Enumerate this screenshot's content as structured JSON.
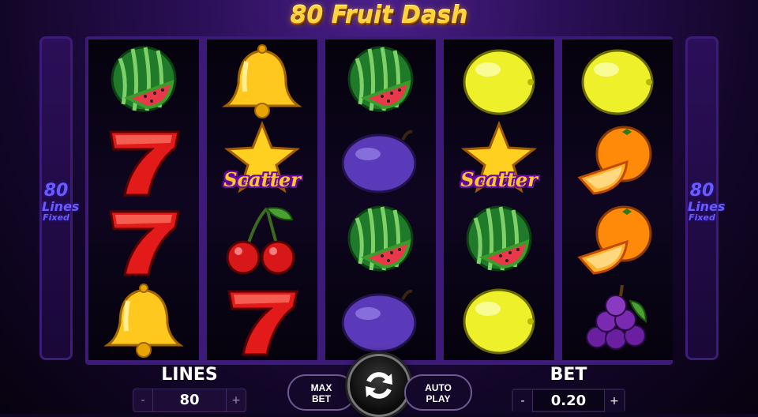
{
  "title": "80 Fruit Dash",
  "side_panel": {
    "number": "80",
    "lines": "Lines",
    "fixed": "Fixed"
  },
  "reels": [
    [
      "watermelon",
      "seven",
      "seven",
      "bell"
    ],
    [
      "bell",
      "scatter",
      "cherries",
      "seven"
    ],
    [
      "watermelon",
      "plum",
      "watermelon",
      "plum"
    ],
    [
      "lemon",
      "scatter",
      "watermelon",
      "lemon"
    ],
    [
      "lemon",
      "orange",
      "orange",
      "grapes"
    ]
  ],
  "scatter_label": "Scatter",
  "controls": {
    "lines_label": "LINES",
    "lines_value": "80",
    "minus": "-",
    "plus": "+",
    "max_bet_line1": "MAX",
    "max_bet_line2": "BET",
    "auto_play_line1": "AUTO",
    "auto_play_line2": "PLAY",
    "bet_label": "BET",
    "bet_value": "0.20",
    "spin_icon": "refresh-icon"
  }
}
